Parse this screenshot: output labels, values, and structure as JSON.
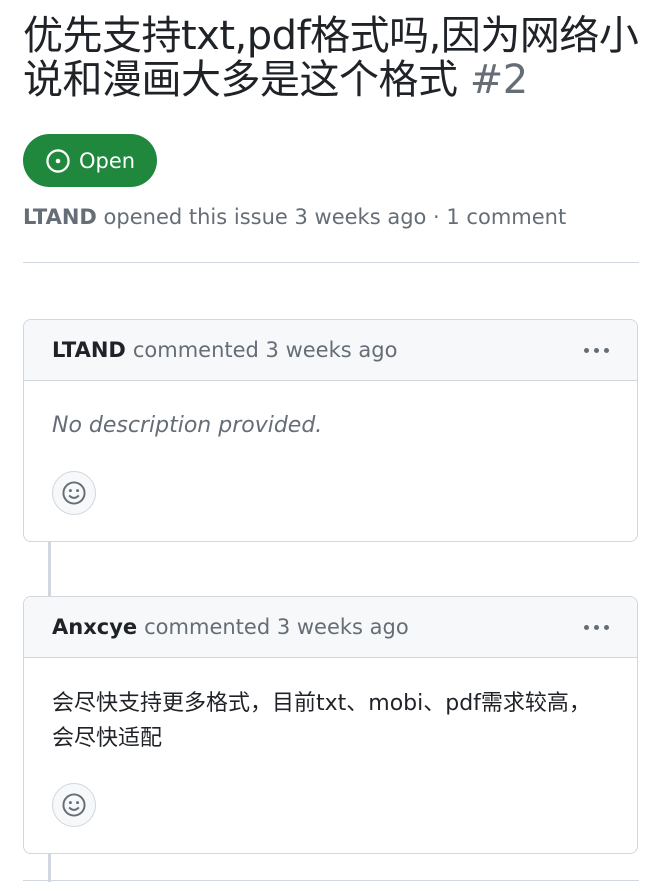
{
  "issue": {
    "title": "优先支持txt,pdf格式吗,因为网络小说和漫画大多是这个格式",
    "number": "#2",
    "state": "Open",
    "state_color": "#1f883d",
    "opener": "LTAND",
    "meta_text": "opened this issue 3 weeks ago · 1 comment"
  },
  "comments": [
    {
      "author": "LTAND",
      "action": "commented 3 weeks ago",
      "body": "No description provided."
    },
    {
      "author": "Anxcye",
      "action": "commented 3 weeks ago",
      "body": "会尽快支持更多格式，目前txt、mobi、pdf需求较高，会尽快适配"
    }
  ],
  "icons": {
    "state": "issue-opened-icon",
    "menu": "kebab-horizontal-icon",
    "reaction": "smiley-icon"
  }
}
